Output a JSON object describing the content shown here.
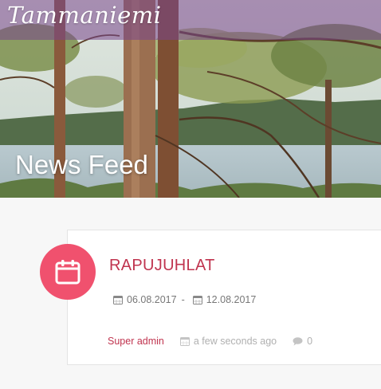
{
  "site": {
    "logo_text": "Tammaniemi"
  },
  "hero": {
    "page_title": "News Feed"
  },
  "event": {
    "title": "RAPUJUHLAT",
    "start_date": "06.08.2017",
    "date_separator": "-",
    "end_date": "12.08.2017",
    "author": "Super admin",
    "posted": "a few seconds ago",
    "comment_count": "0",
    "icons": {
      "badge": "calendar-icon",
      "date": "calendar-icon",
      "posted": "calendar-icon",
      "comments": "comment-icon"
    }
  },
  "colors": {
    "accent": "#c0344f",
    "badge": "#f0516e",
    "header_overlay": "#78468c"
  }
}
